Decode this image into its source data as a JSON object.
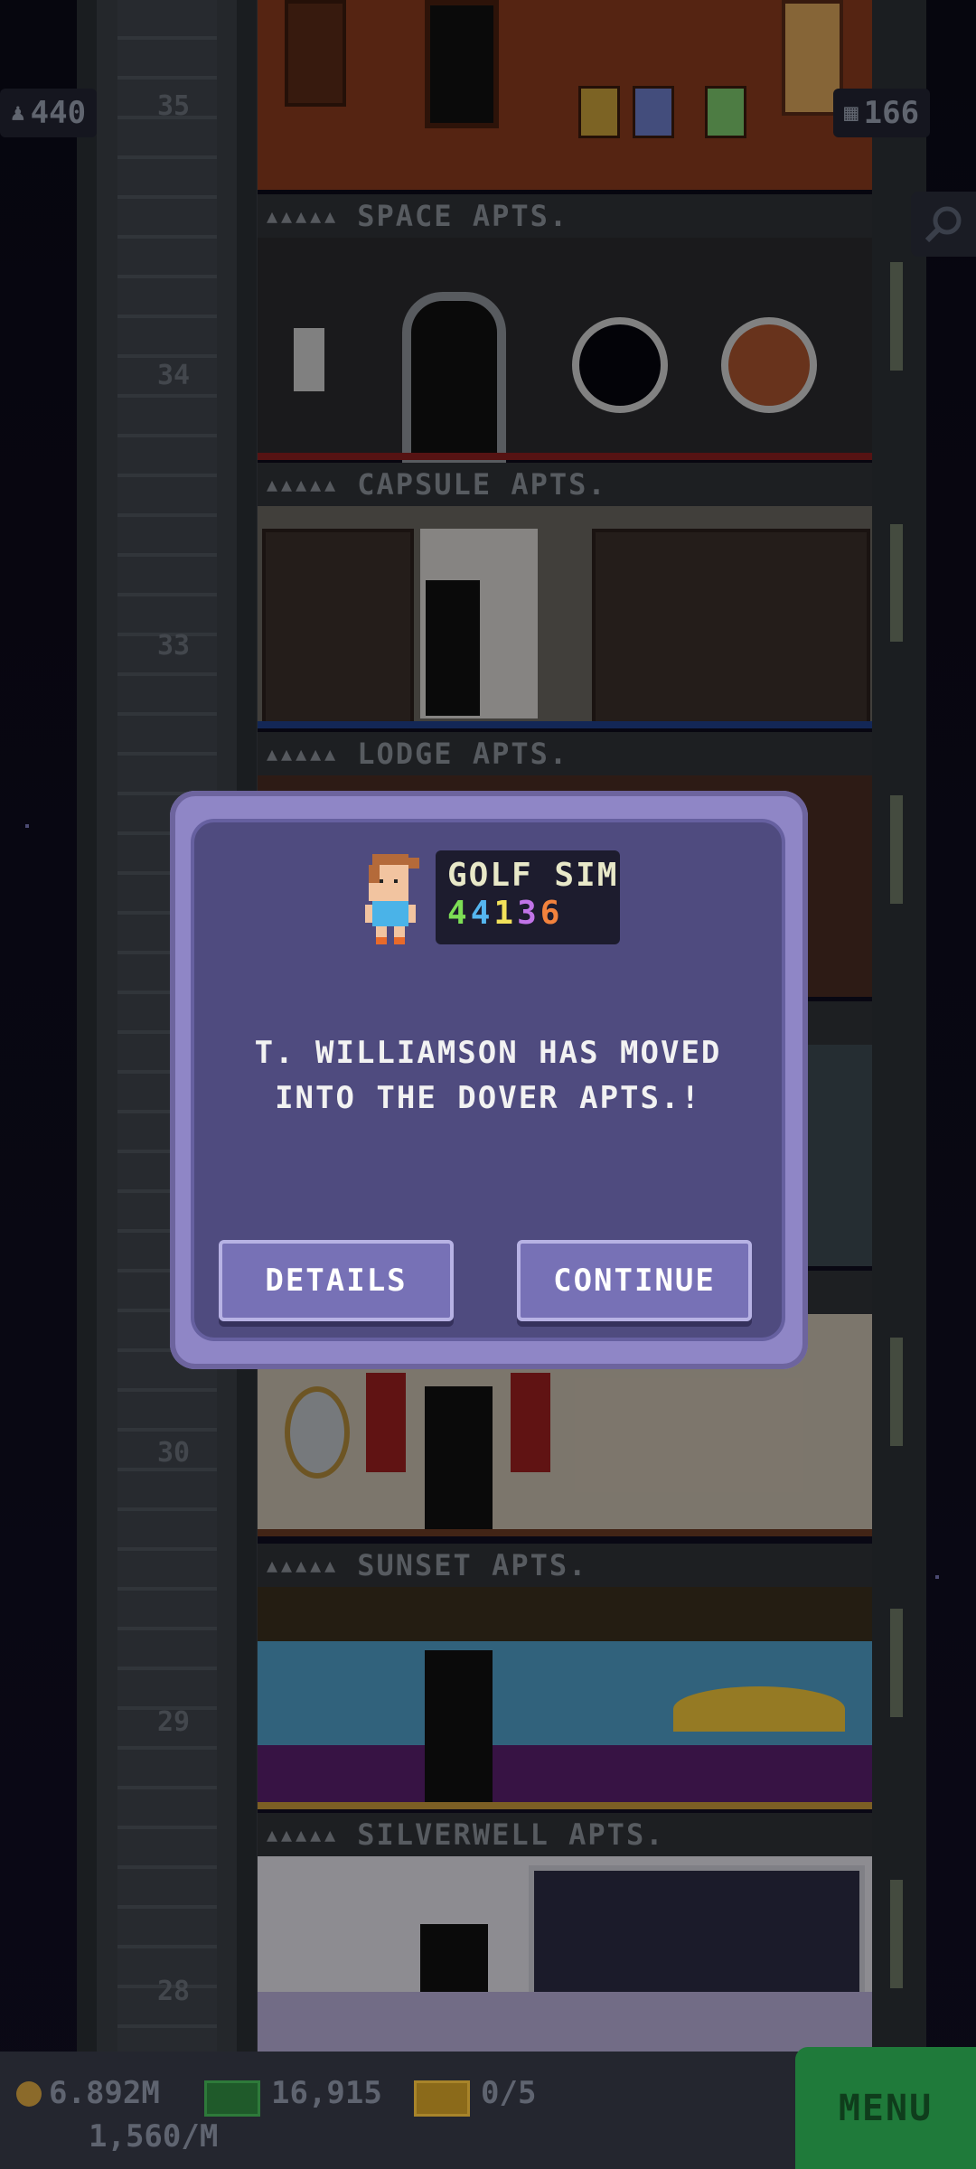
{
  "hud": {
    "population": "440",
    "floors_count": "166"
  },
  "floors": [
    {
      "number": "35",
      "label": "SPACE APTS.",
      "dots": "▲▲▲▲▲"
    },
    {
      "number": "34",
      "label": "CAPSULE APTS.",
      "dots": "▲▲▲▲▲"
    },
    {
      "number": "33",
      "label": "LODGE APTS.",
      "dots": "▲▲▲▲▲"
    },
    {
      "number": "30",
      "label": "SUNSET APTS.",
      "dots": "▲▲▲▲▲"
    },
    {
      "number": "29",
      "label": "SILVERWELL APTS.",
      "dots": "▲▲▲▲▲"
    },
    {
      "number": "28",
      "label": "",
      "dots": ""
    }
  ],
  "dialog": {
    "job_name": "GOLF SIM",
    "job_stats": [
      "4",
      "4",
      "1",
      "3",
      "6"
    ],
    "job_stat_colors": [
      "#7dde55",
      "#55b6f0",
      "#f2e15a",
      "#c174e8",
      "#f2823d"
    ],
    "message": "T. WILLIAMSON HAS MOVED INTO THE DOVER APTS.!",
    "details_label": "DETAILS",
    "continue_label": "CONTINUE"
  },
  "bottom": {
    "coins": "6.892M",
    "bux": "16,915",
    "tickets": "0/5",
    "rate": "1,560/M",
    "menu_label": "MENU"
  },
  "colors": {
    "dialog_border": "#8f86c6",
    "dialog_fill": "#4f4b7f",
    "menu_green": "#1f7a3a"
  }
}
